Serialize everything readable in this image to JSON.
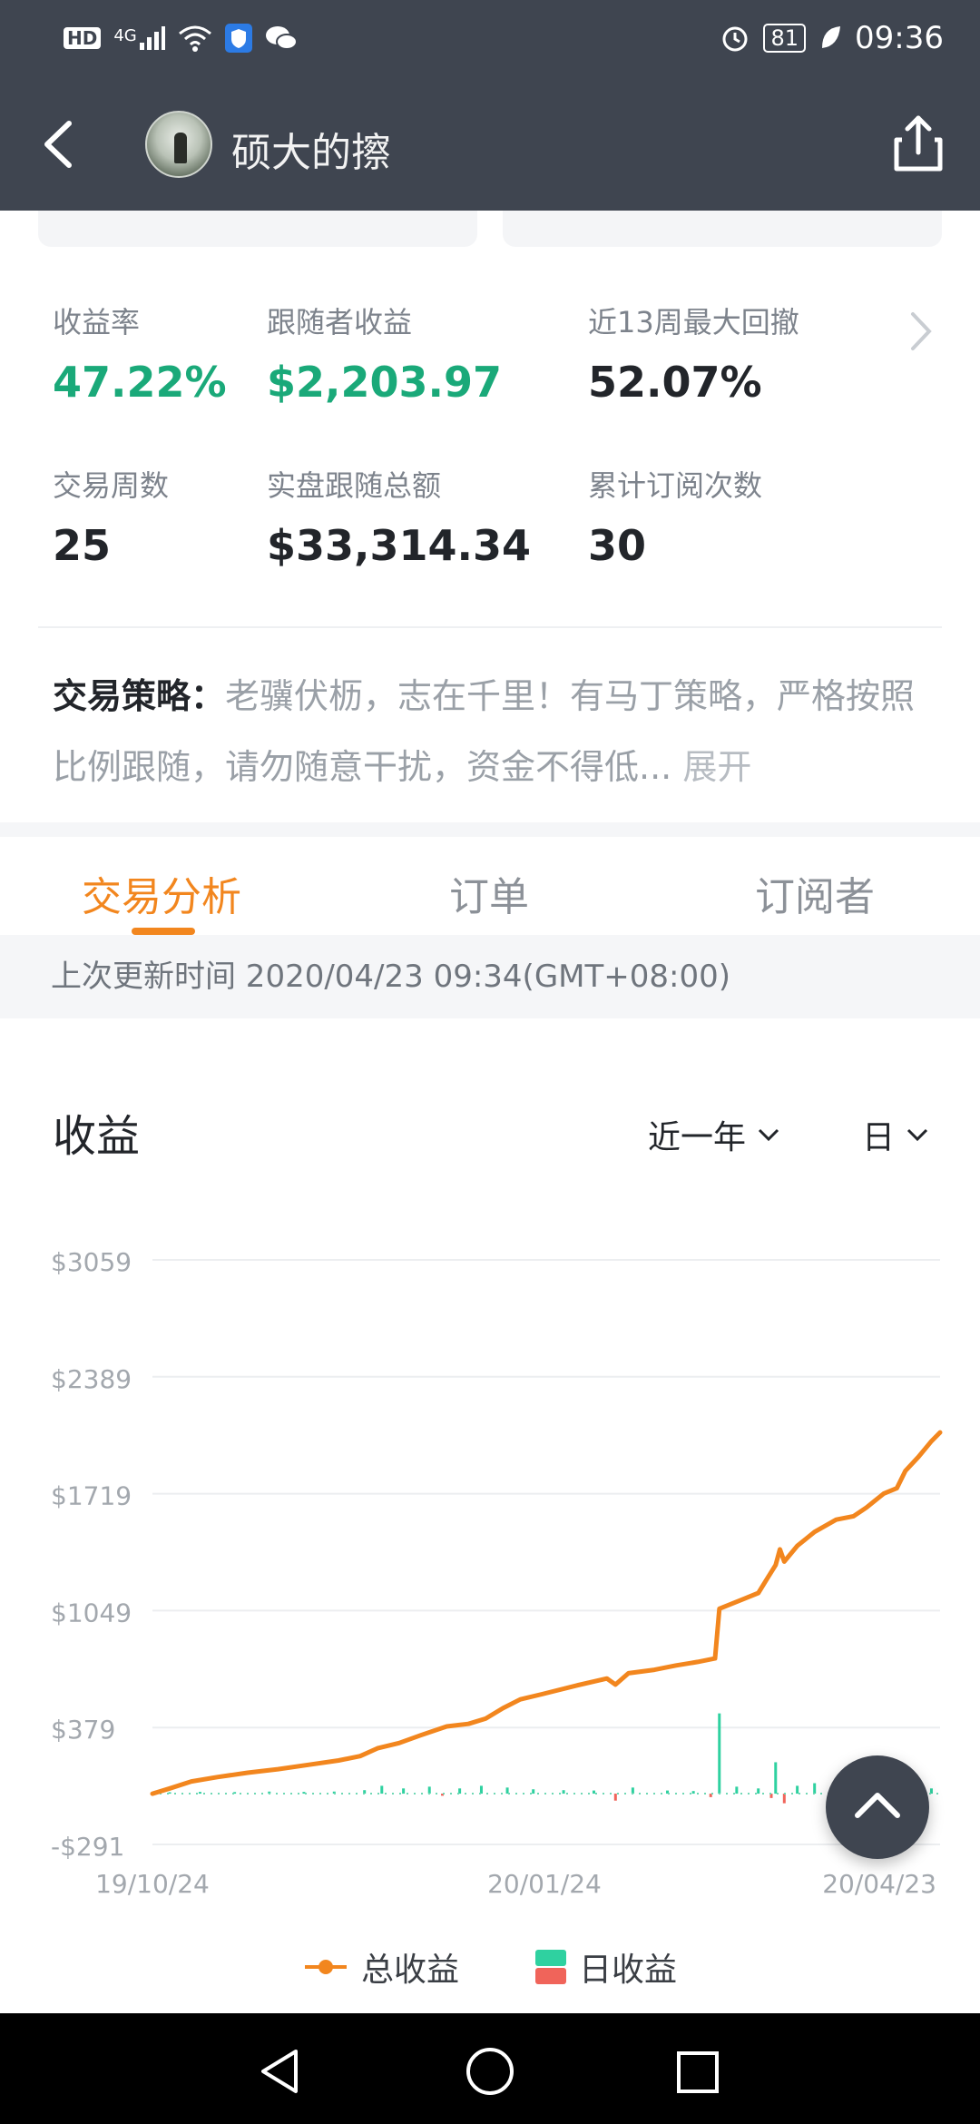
{
  "status_bar": {
    "left_icons": [
      "hd-icon",
      "4g-signal-icon",
      "wifi-icon",
      "shield-app-icon",
      "wechat-icon"
    ],
    "hd_label": "HD",
    "network_label": "4G",
    "battery": "81",
    "time": "09:36"
  },
  "header": {
    "title": "硕大的擦"
  },
  "stats": {
    "return_rate": {
      "label": "收益率",
      "value": "47.22%"
    },
    "follower_profit": {
      "label": "跟随者收益",
      "value": "$2,203.97"
    },
    "max_drawdown": {
      "label": "近13周最大回撤",
      "value": "52.07%"
    },
    "trading_weeks": {
      "label": "交易周数",
      "value": "25"
    },
    "live_follow_total": {
      "label": "实盘跟随总额",
      "value": "$33,314.34"
    },
    "subscriptions": {
      "label": "累计订阅次数",
      "value": "30"
    }
  },
  "strategy": {
    "label": "交易策略：",
    "text": "老骥伏枥，志在千里！有马丁策略，严格按照比例跟随，请勿随意干扰，资金不得低...",
    "expand": "展开"
  },
  "tabs": [
    {
      "label": "交易分析",
      "active": true
    },
    {
      "label": "订单",
      "active": false
    },
    {
      "label": "订阅者",
      "active": false
    }
  ],
  "update_time": "上次更新时间 2020/04/23 09:34(GMT+08:00)",
  "section_title": "收益",
  "range_dropdown": "近一年",
  "period_dropdown": "日",
  "colors": {
    "accent": "#f2861e",
    "green": "#1aa979",
    "daily_positive": "#2fd1a0",
    "daily_negative": "#f0645a",
    "header_bg": "#3f4550"
  },
  "chart_data": {
    "type": "line",
    "y_ticks": [
      "$3059",
      "$2389",
      "$1719",
      "$1049",
      "$379",
      "-$291"
    ],
    "ylim": [
      -291,
      3059
    ],
    "x_ticks": [
      "19/10/24",
      "20/01/24",
      "20/04/23"
    ],
    "x_range": [
      "2019-10-24",
      "2020-04-23"
    ],
    "grid": true,
    "legend_position": "bottom",
    "series": [
      {
        "name": "总收益",
        "points": [
          [
            "2019-10-24",
            0
          ],
          [
            "2019-10-28",
            30
          ],
          [
            "2019-11-02",
            70
          ],
          [
            "2019-11-08",
            95
          ],
          [
            "2019-11-15",
            120
          ],
          [
            "2019-11-22",
            140
          ],
          [
            "2019-11-29",
            165
          ],
          [
            "2019-12-06",
            190
          ],
          [
            "2019-12-11",
            215
          ],
          [
            "2019-12-15",
            260
          ],
          [
            "2019-12-20",
            290
          ],
          [
            "2019-12-25",
            335
          ],
          [
            "2019-12-31",
            385
          ],
          [
            "2020-01-05",
            400
          ],
          [
            "2020-01-09",
            430
          ],
          [
            "2020-01-13",
            490
          ],
          [
            "2020-01-17",
            540
          ],
          [
            "2020-01-22",
            570
          ],
          [
            "2020-01-30",
            620
          ],
          [
            "2020-02-06",
            660
          ],
          [
            "2020-02-08",
            625
          ],
          [
            "2020-02-11",
            690
          ],
          [
            "2020-02-17",
            710
          ],
          [
            "2020-02-22",
            735
          ],
          [
            "2020-02-27",
            755
          ],
          [
            "2020-03-02",
            775
          ],
          [
            "2020-03-03",
            1060
          ],
          [
            "2020-03-09",
            1120
          ],
          [
            "2020-03-12",
            1150
          ],
          [
            "2020-03-14",
            1230
          ],
          [
            "2020-03-16",
            1310
          ],
          [
            "2020-03-17",
            1400
          ],
          [
            "2020-03-18",
            1330
          ],
          [
            "2020-03-21",
            1420
          ],
          [
            "2020-03-25",
            1500
          ],
          [
            "2020-03-30",
            1570
          ],
          [
            "2020-04-03",
            1590
          ],
          [
            "2020-04-06",
            1640
          ],
          [
            "2020-04-10",
            1720
          ],
          [
            "2020-04-13",
            1750
          ],
          [
            "2020-04-15",
            1850
          ],
          [
            "2020-04-18",
            1930
          ],
          [
            "2020-04-21",
            2020
          ],
          [
            "2020-04-23",
            2070
          ]
        ]
      },
      {
        "name": "日收益",
        "type": "bar",
        "points": [
          [
            "2019-10-28",
            8
          ],
          [
            "2019-11-04",
            10
          ],
          [
            "2019-11-12",
            9
          ],
          [
            "2019-11-20",
            12
          ],
          [
            "2019-11-28",
            10
          ],
          [
            "2019-12-05",
            12
          ],
          [
            "2019-12-12",
            20
          ],
          [
            "2019-12-16",
            45
          ],
          [
            "2019-12-21",
            30
          ],
          [
            "2019-12-27",
            40
          ],
          [
            "2019-12-30",
            -12
          ],
          [
            "2020-01-03",
            30
          ],
          [
            "2020-01-08",
            45
          ],
          [
            "2020-01-14",
            35
          ],
          [
            "2020-01-20",
            25
          ],
          [
            "2020-01-27",
            20
          ],
          [
            "2020-02-03",
            18
          ],
          [
            "2020-02-08",
            -40
          ],
          [
            "2020-02-12",
            35
          ],
          [
            "2020-02-20",
            18
          ],
          [
            "2020-02-26",
            15
          ],
          [
            "2020-03-01",
            -20
          ],
          [
            "2020-03-03",
            460
          ],
          [
            "2020-03-07",
            40
          ],
          [
            "2020-03-12",
            30
          ],
          [
            "2020-03-15",
            -25
          ],
          [
            "2020-03-16",
            180
          ],
          [
            "2020-03-18",
            -55
          ],
          [
            "2020-03-21",
            45
          ],
          [
            "2020-03-25",
            60
          ],
          [
            "2020-03-30",
            40
          ],
          [
            "2020-04-03",
            25
          ],
          [
            "2020-04-08",
            30
          ],
          [
            "2020-04-13",
            25
          ],
          [
            "2020-04-17",
            35
          ],
          [
            "2020-04-21",
            30
          ]
        ]
      }
    ]
  },
  "legend": {
    "total": "总收益",
    "daily": "日收益"
  }
}
